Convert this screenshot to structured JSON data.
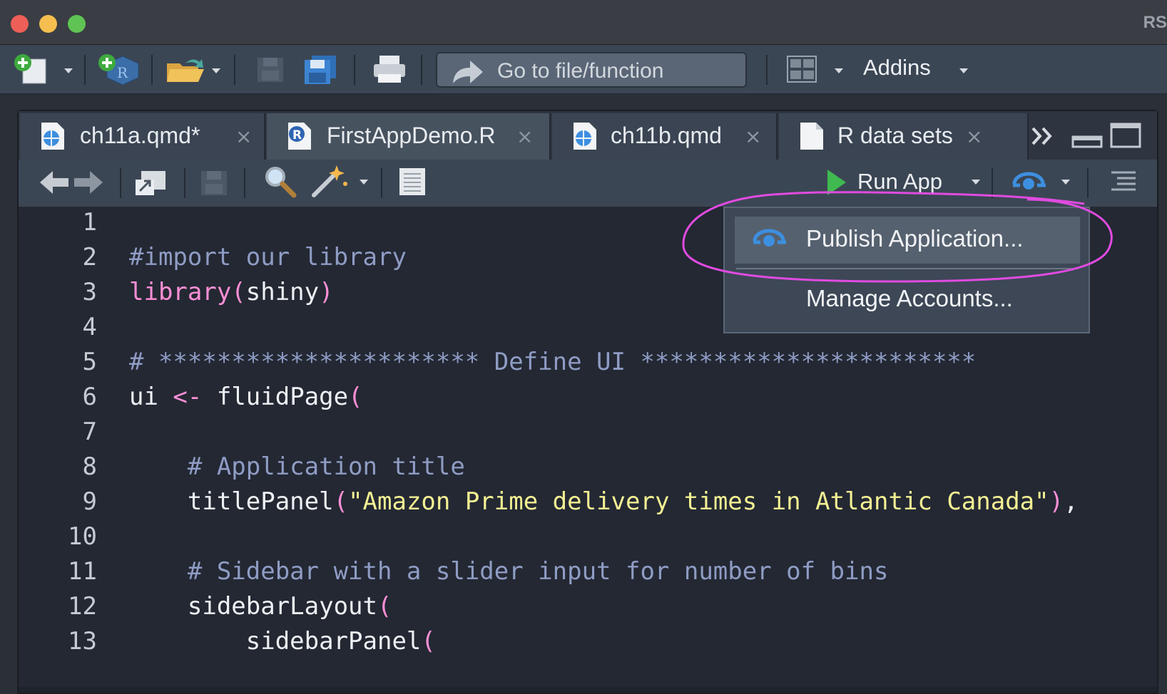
{
  "window": {
    "title": "RS"
  },
  "toolbar": {
    "goto_placeholder": "Go to file/function",
    "addins_label": "Addins"
  },
  "tabs": [
    {
      "label": "ch11a.qmd*",
      "icon": "qmd-file-icon",
      "active": false
    },
    {
      "label": "FirstAppDemo.R",
      "icon": "r-file-icon",
      "active": true
    },
    {
      "label": "ch11b.qmd",
      "icon": "qmd-file-icon",
      "active": false
    },
    {
      "label": "R data sets",
      "icon": "document-icon",
      "active": false
    }
  ],
  "tab_close_glyph": "×",
  "editor_toolbar": {
    "run_label": "Run App"
  },
  "publish_menu": {
    "items": [
      {
        "label": "Publish Application...",
        "highlighted": true
      },
      {
        "label": "Manage Accounts...",
        "highlighted": false
      }
    ]
  },
  "editor": {
    "line_numbers": [
      "1",
      "2",
      "3",
      "4",
      "5",
      "6",
      "7",
      "8",
      "9",
      "10",
      "11",
      "12",
      "13"
    ],
    "lines": [
      {
        "indent": "",
        "parts": []
      },
      {
        "indent": "",
        "parts": [
          {
            "t": "#import our library",
            "c": "comment"
          }
        ]
      },
      {
        "indent": "",
        "parts": [
          {
            "t": "library(",
            "c": "kw"
          },
          {
            "t": "shiny",
            "c": "plain"
          },
          {
            "t": ")",
            "c": "kw"
          }
        ]
      },
      {
        "indent": "",
        "parts": []
      },
      {
        "indent": "",
        "parts": [
          {
            "t": "# ********************** Define UI ***********************",
            "c": "comment"
          }
        ]
      },
      {
        "indent": "",
        "parts": [
          {
            "t": "ui ",
            "c": "plain"
          },
          {
            "t": "<-",
            "c": "op"
          },
          {
            "t": " fluidPage",
            "c": "plain"
          },
          {
            "t": "(",
            "c": "kw"
          }
        ]
      },
      {
        "indent": "",
        "parts": []
      },
      {
        "indent": "    ",
        "parts": [
          {
            "t": "# Application title",
            "c": "comment"
          }
        ]
      },
      {
        "indent": "    ",
        "parts": [
          {
            "t": "titlePanel",
            "c": "plain"
          },
          {
            "t": "(",
            "c": "kw"
          },
          {
            "t": "\"Amazon Prime delivery times in Atlantic Canada\"",
            "c": "str"
          },
          {
            "t": ")",
            "c": "kw"
          },
          {
            "t": ",",
            "c": "plain"
          }
        ]
      },
      {
        "indent": "",
        "parts": []
      },
      {
        "indent": "    ",
        "parts": [
          {
            "t": "# Sidebar with a slider input for number of bins",
            "c": "comment"
          }
        ]
      },
      {
        "indent": "    ",
        "parts": [
          {
            "t": "sidebarLayout",
            "c": "plain"
          },
          {
            "t": "(",
            "c": "kw"
          }
        ]
      },
      {
        "indent": "        ",
        "parts": [
          {
            "t": "sidebarPanel",
            "c": "plain"
          },
          {
            "t": "(",
            "c": "kw"
          }
        ]
      }
    ]
  },
  "colors": {
    "annotation": "#e04be0",
    "accent_blue": "#3d8fe0",
    "run_green": "#3fb950"
  }
}
